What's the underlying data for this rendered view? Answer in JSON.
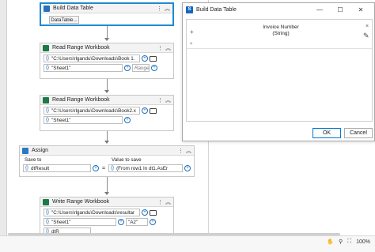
{
  "build_data_table_activity": {
    "title": "Build Data Table",
    "button_label": "DataTable..."
  },
  "read_range_1": {
    "title": "Read Range Workbook",
    "path": "\"C:\\Users\\rlgandu\\Downloads\\Book 1.",
    "sheet": "\"Sheet1\"",
    "range_placeholder": "Range"
  },
  "read_range_2": {
    "title": "Read Range Workbook",
    "path": "\"C:\\Users\\rlgandu\\Downloads\\Book2.x",
    "sheet": "\"Sheet1\""
  },
  "assign": {
    "title": "Assign",
    "save_to_label": "Save to",
    "value_label": "Value to save",
    "save_to_value": "dtResult",
    "equals": "=",
    "value_expression": "(From row1 In dt1.AsEr"
  },
  "write_range": {
    "title": "Write Range Workbook",
    "path": "\"C:\\Users\\rlgandu\\Downloads\\resultar",
    "sheet": "\"Sheet1\"",
    "start_cell": "\"A2\"",
    "partial": "dtR"
  },
  "dialog": {
    "title": "Build Data Table",
    "logo": "S",
    "column_header_line1": "Invoice Number",
    "column_header_line2": "(String)",
    "ok_label": "OK",
    "cancel_label": "Cancel",
    "add_column_icon": "+",
    "add_row_icon": "+",
    "remove_column_icon": "×"
  },
  "statusbar": {
    "zoom": "100%"
  },
  "colors": {
    "selection_blue": "#1e8ad3",
    "excel_green": "#1d7a46"
  }
}
